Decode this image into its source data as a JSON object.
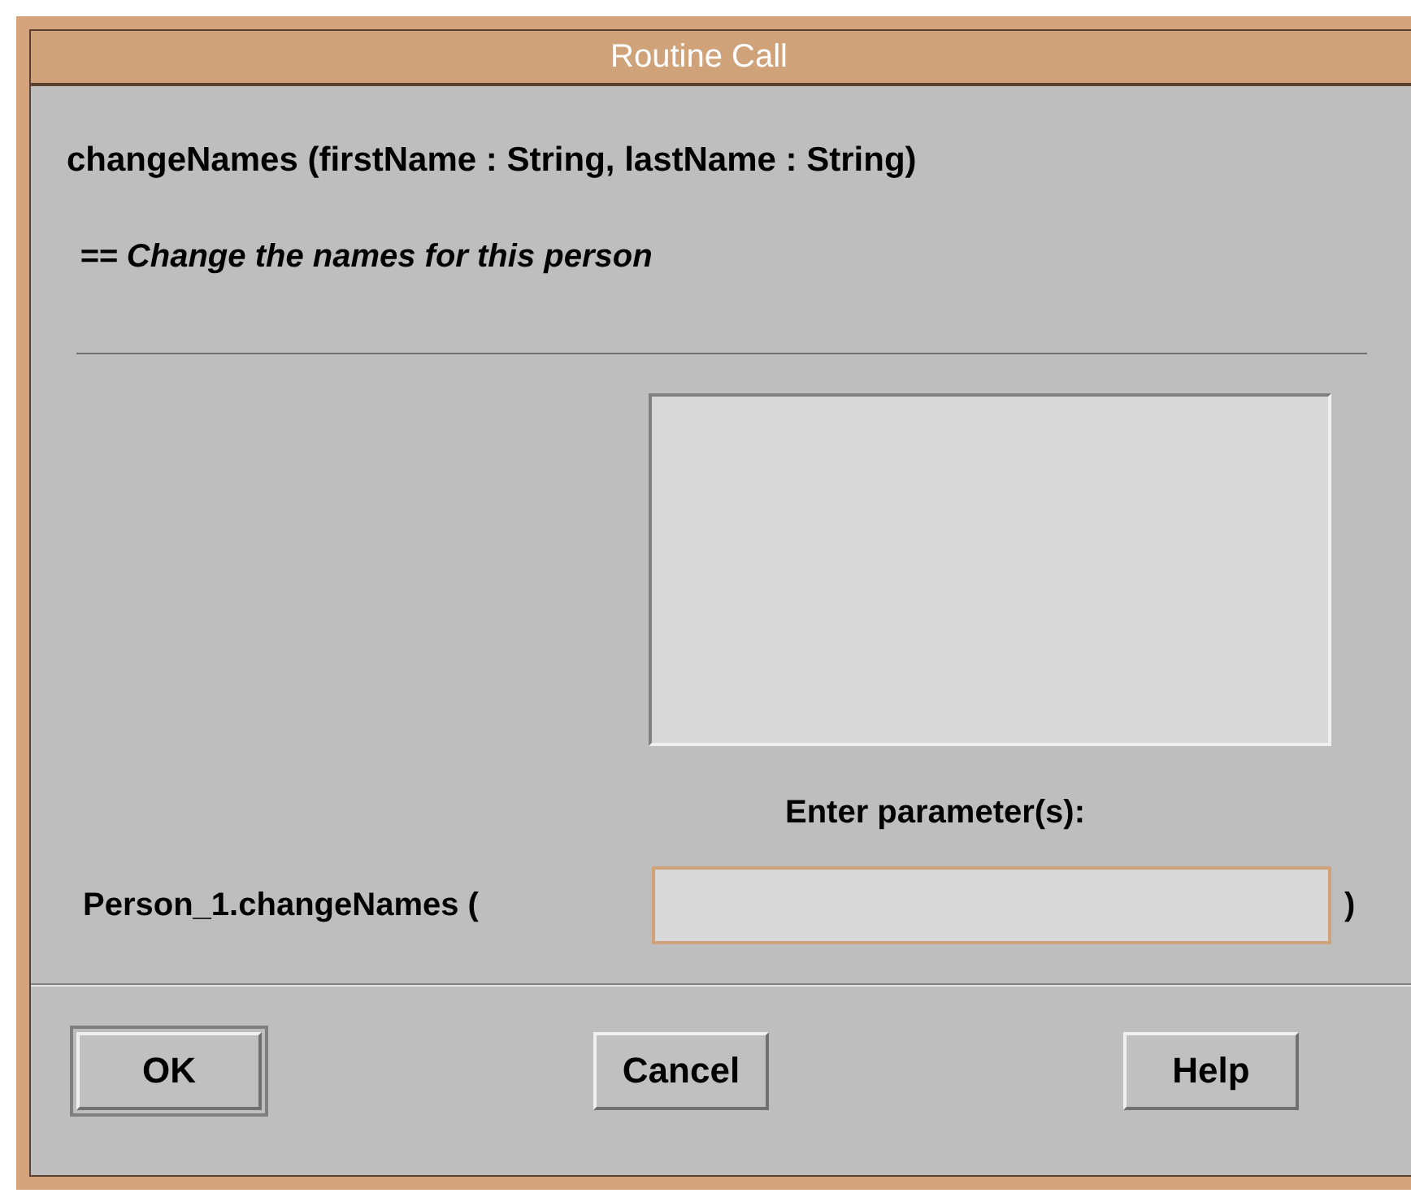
{
  "window": {
    "title": "Routine Call"
  },
  "signature": "changeNames (firstName : String, lastName : String)",
  "comment": "== Change the names for this person",
  "prompt": "Enter parameter(s):",
  "call": {
    "prefix": "Person_1.changeNames (",
    "suffix": ")"
  },
  "buttons": [
    {
      "label": "OK",
      "default": true
    },
    {
      "label": "Cancel",
      "default": false
    },
    {
      "label": "Help",
      "default": false
    }
  ]
}
